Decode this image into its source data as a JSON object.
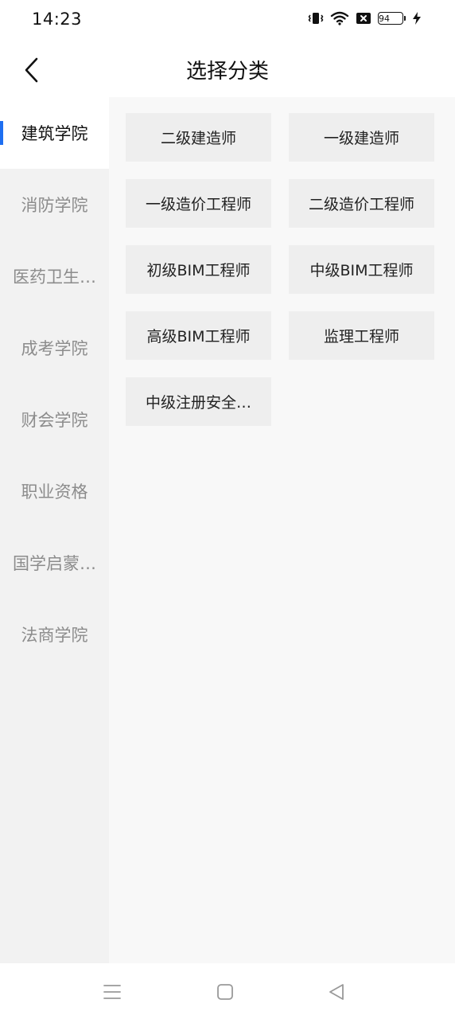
{
  "status_bar": {
    "time": "14:23",
    "battery_level": "94",
    "icons": [
      "vibrate-icon",
      "wifi-icon",
      "no-sim-icon",
      "battery-icon",
      "charging-icon"
    ]
  },
  "header": {
    "title": "选择分类",
    "back_icon": "chevron-left-icon"
  },
  "sidebar": {
    "active_index": 0,
    "accent_color": "#1e6ff1",
    "items": [
      {
        "label": "建筑学院"
      },
      {
        "label": "消防学院"
      },
      {
        "label": "医药卫生…"
      },
      {
        "label": "成考学院"
      },
      {
        "label": "财会学院"
      },
      {
        "label": "职业资格"
      },
      {
        "label": "国学启蒙…"
      },
      {
        "label": "法商学院"
      }
    ]
  },
  "categories": [
    {
      "label": "二级建造师"
    },
    {
      "label": "一级建造师"
    },
    {
      "label": "一级造价工程师"
    },
    {
      "label": "二级造价工程师"
    },
    {
      "label": "初级BIM工程师"
    },
    {
      "label": "中级BIM工程师"
    },
    {
      "label": "高级BIM工程师"
    },
    {
      "label": "监理工程师"
    },
    {
      "label": "中级注册安全…"
    }
  ],
  "nav_bar": {
    "icons": [
      "menu-icon",
      "home-icon",
      "back-icon"
    ]
  }
}
